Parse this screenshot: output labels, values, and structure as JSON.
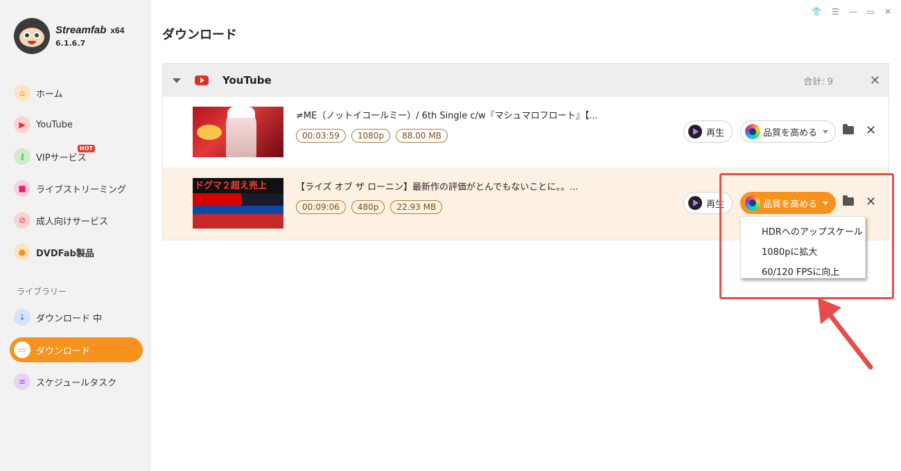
{
  "app": {
    "name": "Streamfab",
    "arch": "x64",
    "version": "6.1.6.7"
  },
  "window_controls": [
    "shirt-icon",
    "menu-icon",
    "minimize-icon",
    "restore-icon",
    "close-icon"
  ],
  "sidebar": {
    "items": [
      {
        "label": "ホーム",
        "icon": "home-icon",
        "color": "#f7921e"
      },
      {
        "label": "YouTube",
        "icon": "youtube-icon",
        "color": "#e52d27"
      },
      {
        "label": "VIPサービス",
        "icon": "key-icon",
        "color": "#3cb043",
        "badge": "HOT"
      },
      {
        "label": "ライブストリーミング",
        "icon": "camera-icon",
        "color": "#e91e63"
      },
      {
        "label": "成人向けサービス",
        "icon": "adult-block-icon",
        "color": "#e53935"
      },
      {
        "label": "DVDFab製品",
        "icon": "dvdfab-icon",
        "color": "#f7921e"
      }
    ],
    "library_label": "ライブラリー",
    "library": [
      {
        "label": "ダウンロード 中",
        "icon": "download-arrow-icon",
        "color": "#3d7fe0"
      },
      {
        "label": "ダウンロード",
        "icon": "folder-icon",
        "color": "#f7921e",
        "active": true
      },
      {
        "label": "スケジュールタスク",
        "icon": "schedule-icon",
        "color": "#9c4fd6"
      }
    ]
  },
  "page": {
    "title": "ダウンロード"
  },
  "group": {
    "name": "YouTube",
    "total_label": "合計: 9",
    "rows": [
      {
        "title": "≠ME（ノットイコールミー）/ 6th Single c/w『マシュマロフロート』【...",
        "duration": "00:03:59",
        "resolution": "1080p",
        "size": "88.00 MB",
        "play_label": "再生",
        "enhance_label": "品質を高める"
      },
      {
        "title": "【ライズ オブ ザ ローニン】最新作の評価がとんでもないことに。。...",
        "duration": "00:09:06",
        "resolution": "480p",
        "size": "22.93 MB",
        "play_label": "再生",
        "enhance_label": "品質を高める",
        "thumb_text": "ドグマ２超え売上"
      }
    ]
  },
  "dropdown": {
    "options": [
      "HDRへのアップスケール",
      "1080pに拡大",
      "60/120 FPSに向上"
    ]
  },
  "colors": {
    "accent": "#f7921e",
    "annotation": "#e74c4c",
    "row_highlight": "#fdf1e3"
  }
}
